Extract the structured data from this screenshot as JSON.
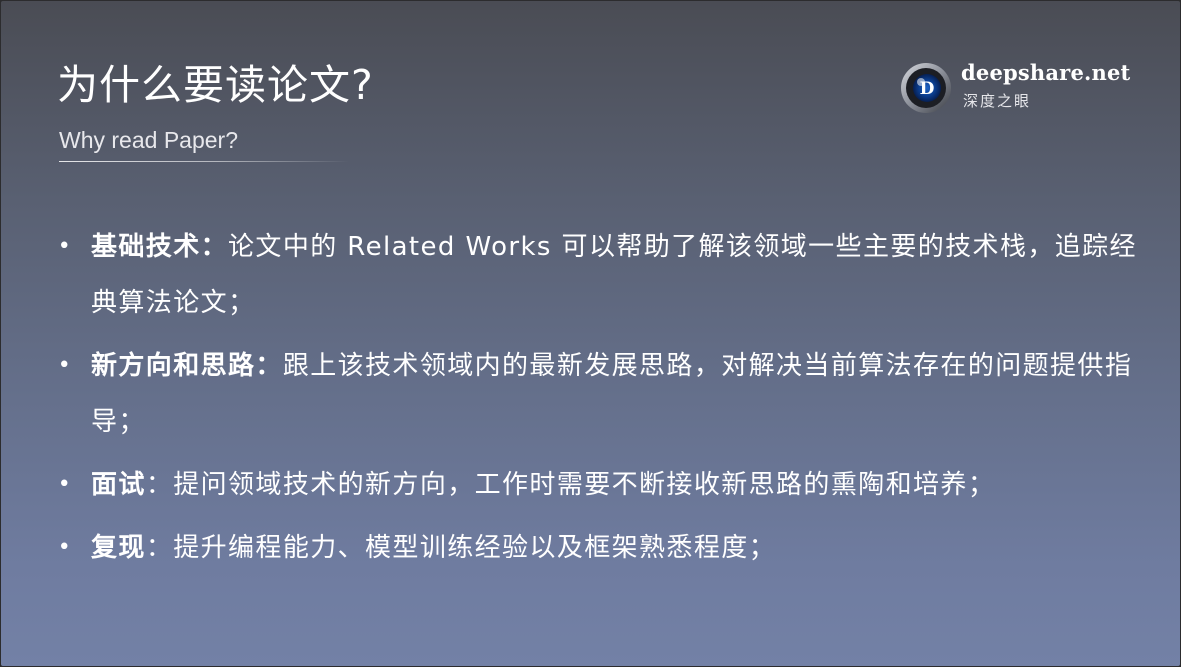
{
  "slide": {
    "title": "为什么要读论文?",
    "subtitle": "Why read Paper?",
    "logo": {
      "name": "deepshare.net",
      "tagline": "深度之眼",
      "mark_letter": "D",
      "icon": "eye-logo-icon"
    },
    "bullets": [
      {
        "term": "基础技术",
        "separator": "：",
        "text": "论文中的 Related Works 可以帮助了解该领域一些主要的技术栈，追踪经典算法论文；"
      },
      {
        "term": "新方向和思路",
        "separator": "：",
        "text": "跟上该技术领域内的最新发展思路，对解决当前算法存在的问题提供指导；"
      },
      {
        "term": "面试",
        "separator": "：",
        "text": "提问领域技术的新方向，工作时需要不断接收新思路的熏陶和培养；"
      },
      {
        "term": "复现",
        "separator": "：",
        "text": "提升编程能力、模型训练经验以及框架熟悉程度；"
      }
    ],
    "bullet_symbol": "•"
  },
  "colors": {
    "background_top": "#4a4c54",
    "background_bottom": "#7381a6",
    "text": "#ffffff"
  }
}
